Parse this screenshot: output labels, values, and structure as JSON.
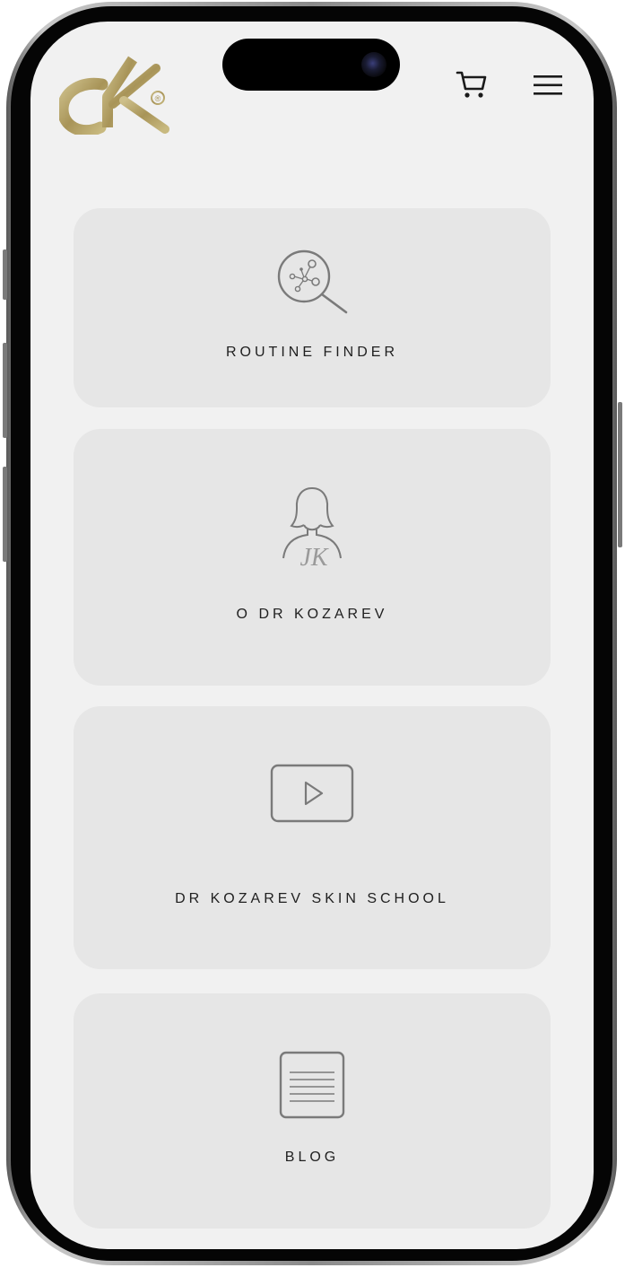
{
  "header": {
    "logo_text": "dk",
    "logo_mark": "®",
    "cart_icon": "cart-icon",
    "menu_icon": "hamburger-menu-icon"
  },
  "cards": [
    {
      "label": "ROUTINE FINDER",
      "icon": "molecule-search-icon"
    },
    {
      "label": "O DR KOZAREV",
      "icon": "woman-avatar-icon",
      "icon_text": "JK"
    },
    {
      "label": "DR KOZAREV SKIN SCHOOL",
      "icon": "video-play-icon"
    },
    {
      "label": "BLOG",
      "icon": "document-lines-icon"
    }
  ],
  "colors": {
    "screen_bg": "#f1f1f1",
    "card_bg": "#e6e6e6",
    "logo_gold": "#b6a46a",
    "text": "#1f1f1f",
    "icon_stroke": "#7a7a7a"
  }
}
